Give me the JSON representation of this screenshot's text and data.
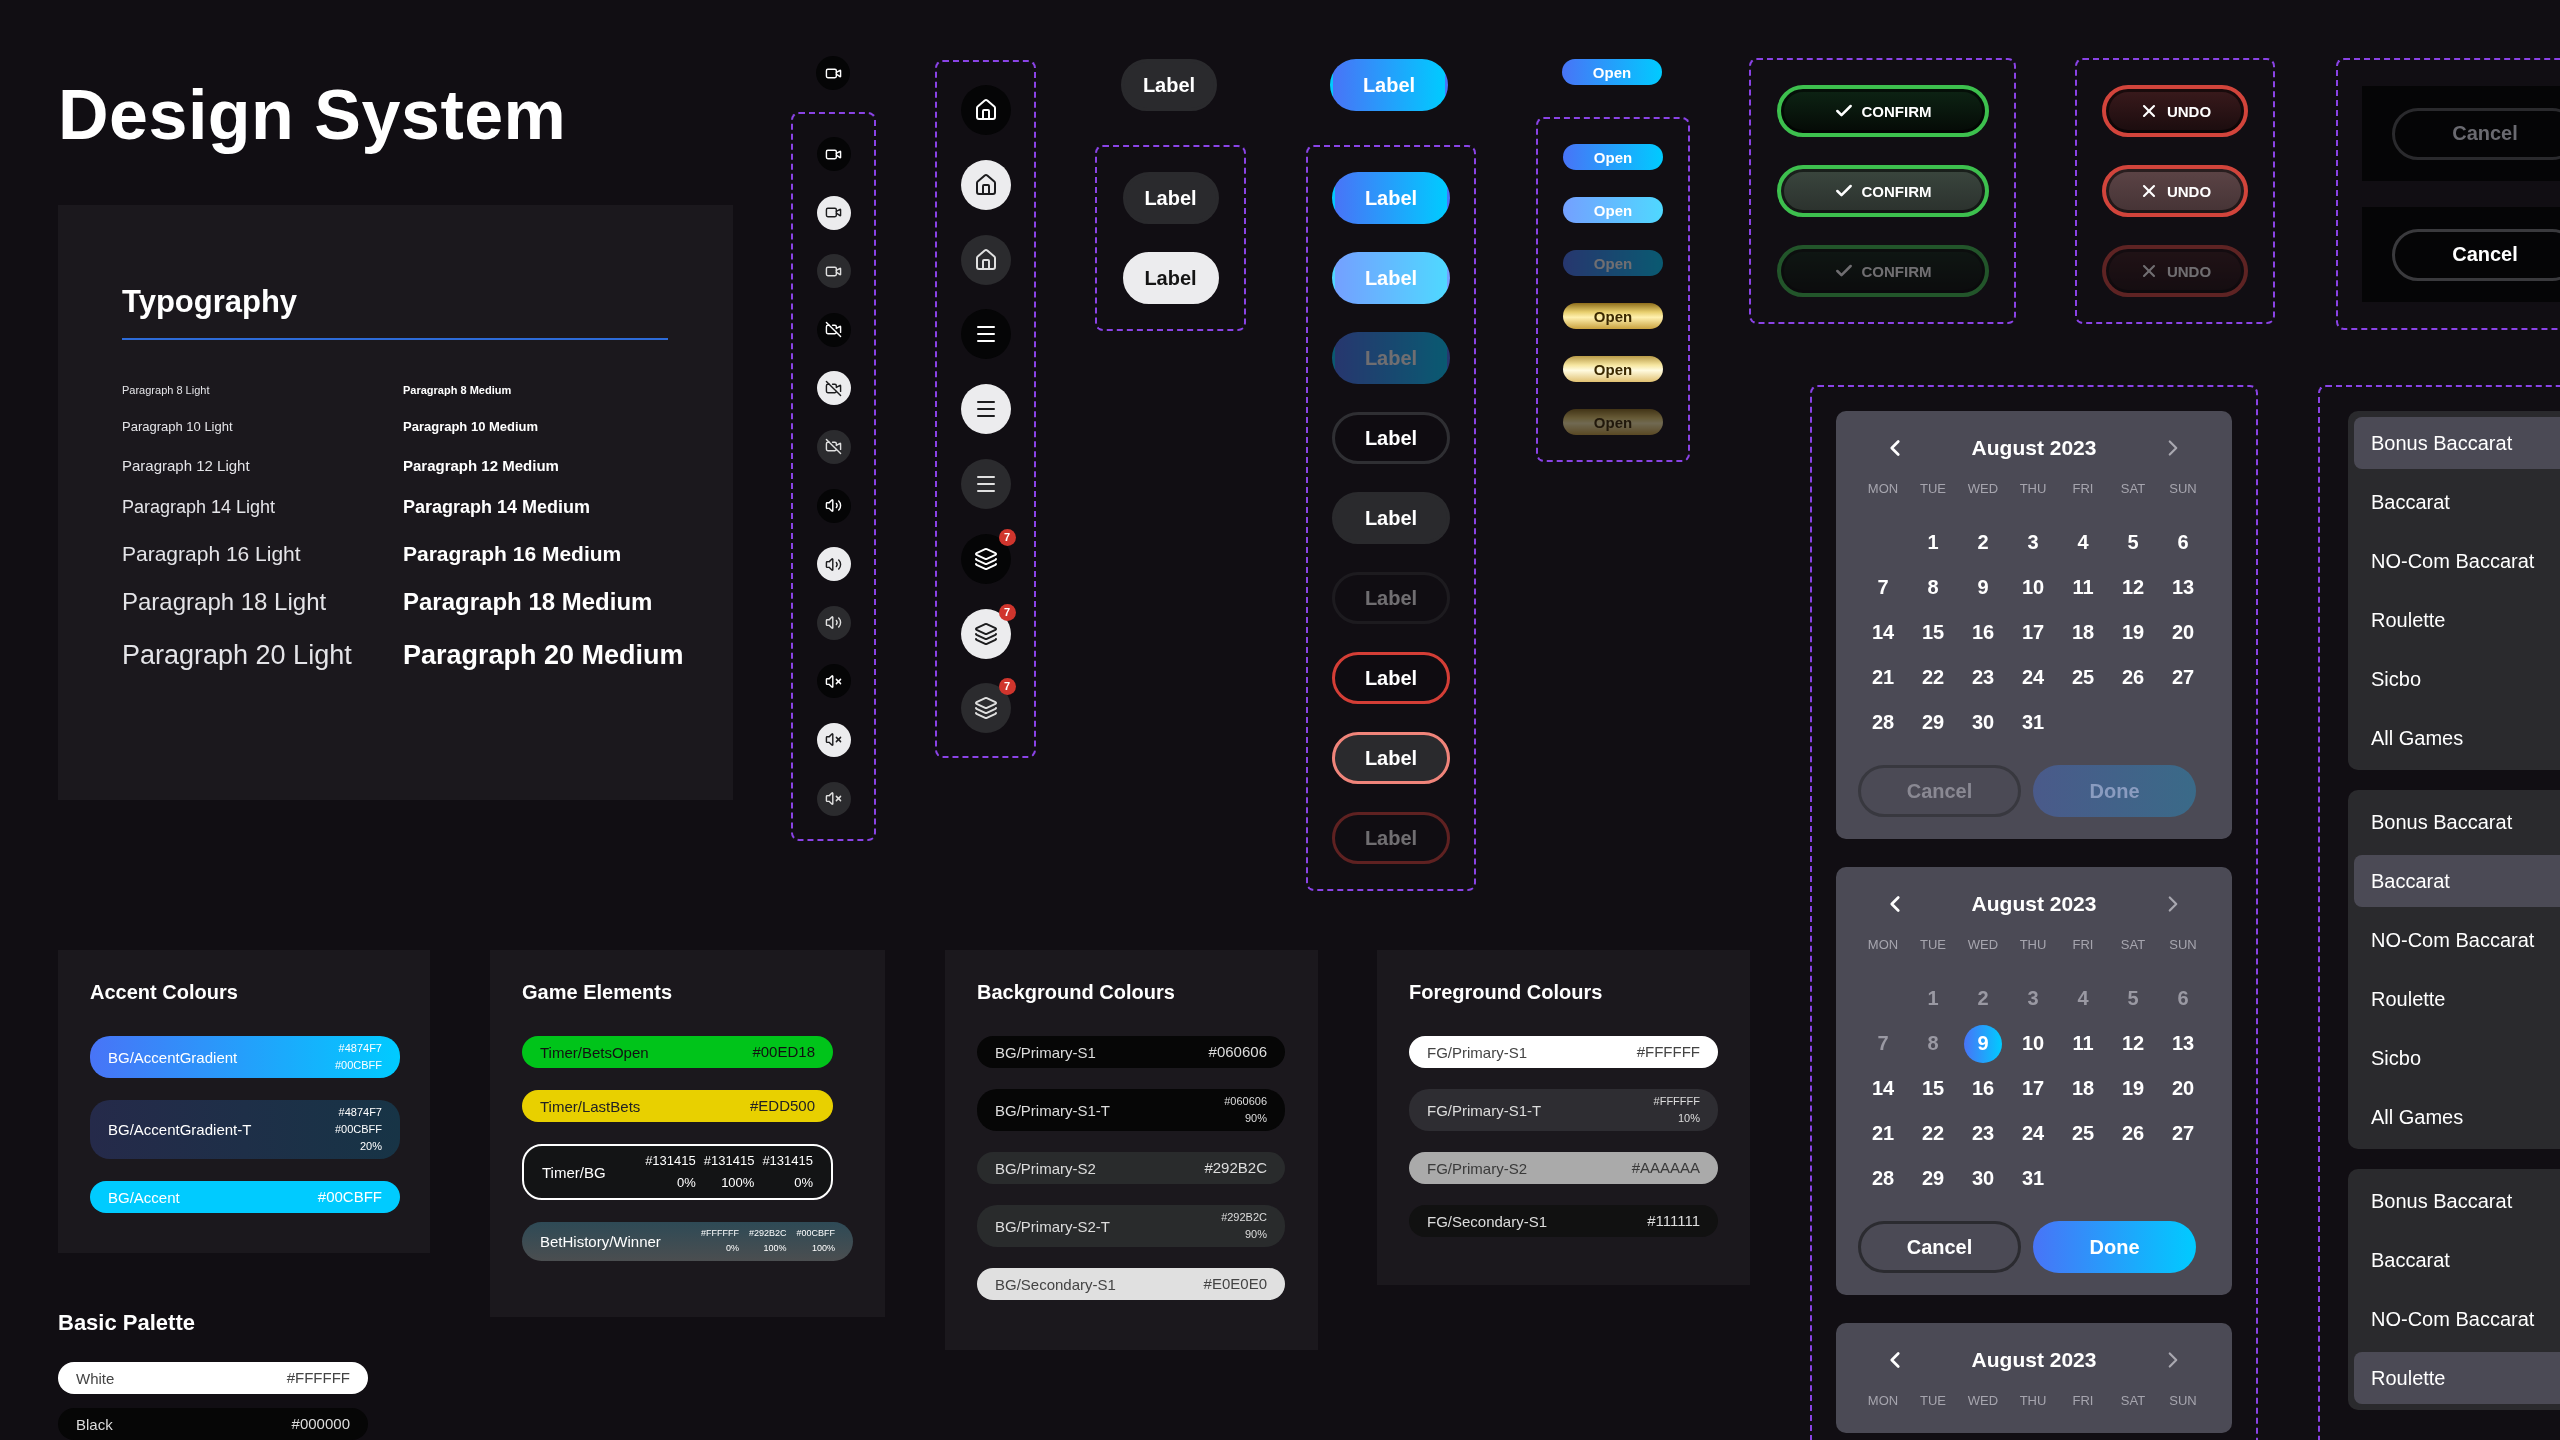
{
  "title": "Design System",
  "typography": {
    "heading": "Typography",
    "rows": [
      {
        "light": "Paragraph 8 Light",
        "medium": "Paragraph 8 Medium"
      },
      {
        "light": "Paragraph 10 Light",
        "medium": "Paragraph 10 Medium"
      },
      {
        "light": "Paragraph 12 Light",
        "medium": "Paragraph 12 Medium"
      },
      {
        "light": "Paragraph 14 Light",
        "medium": "Paragraph 14 Medium"
      },
      {
        "light": "Paragraph 16 Light",
        "medium": "Paragraph 16 Medium"
      },
      {
        "light": "Paragraph 18 Light",
        "medium": "Paragraph 18 Medium"
      },
      {
        "light": "Paragraph 20 Light",
        "medium": "Paragraph 20 Medium"
      }
    ]
  },
  "small_icon_buttons": {
    "sample": {
      "kind": "video"
    },
    "items": [
      {
        "kind": "video"
      },
      {
        "kind": "video"
      },
      {
        "kind": "video"
      },
      {
        "kind": "video-off"
      },
      {
        "kind": "video-off"
      },
      {
        "kind": "video-off"
      },
      {
        "kind": "volume"
      },
      {
        "kind": "volume"
      },
      {
        "kind": "volume"
      },
      {
        "kind": "mute"
      },
      {
        "kind": "mute"
      },
      {
        "kind": "mute"
      }
    ]
  },
  "large_icon_buttons": [
    {
      "kind": "home"
    },
    {
      "kind": "home"
    },
    {
      "kind": "home"
    },
    {
      "kind": "menu"
    },
    {
      "kind": "menu"
    },
    {
      "kind": "menu"
    },
    {
      "kind": "layers",
      "badge": "7"
    },
    {
      "kind": "layers",
      "badge": "7"
    },
    {
      "kind": "layers",
      "badge": "7"
    }
  ],
  "neutral_buttons": {
    "sample": {
      "label": "Label"
    },
    "items": [
      {
        "label": "Label"
      },
      {
        "label": "Label"
      }
    ]
  },
  "primary_buttons": {
    "sample": {
      "label": "Label"
    },
    "items": [
      {
        "label": "Label",
        "disabled": false
      },
      {
        "label": "Label",
        "disabled": false
      },
      {
        "label": "Label",
        "disabled": true
      },
      {
        "label": "Label",
        "disabled": false
      },
      {
        "label": "Label",
        "disabled": false
      },
      {
        "label": "Label",
        "disabled": true
      },
      {
        "label": "Label",
        "disabled": false
      },
      {
        "label": "Label",
        "disabled": false
      },
      {
        "label": "Label",
        "disabled": true
      }
    ]
  },
  "open_badges": {
    "sample": {
      "label": "Open"
    },
    "items": [
      {
        "label": "Open",
        "disabled": false
      },
      {
        "label": "Open",
        "disabled": false
      },
      {
        "label": "Open",
        "disabled": true
      },
      {
        "label": "Open",
        "disabled": false
      },
      {
        "label": "Open",
        "disabled": false
      },
      {
        "label": "Open",
        "disabled": true
      }
    ]
  },
  "confirm_buttons": [
    {
      "label": "CONFIRM",
      "disabled": false
    },
    {
      "label": "CONFIRM",
      "disabled": false
    },
    {
      "label": "CONFIRM",
      "disabled": true
    }
  ],
  "undo_buttons": [
    {
      "label": "UNDO",
      "disabled": false
    },
    {
      "label": "UNDO",
      "disabled": false
    },
    {
      "label": "UNDO",
      "disabled": true
    }
  ],
  "cancel_buttons": [
    {
      "label": "Cancel",
      "disabled": true
    },
    {
      "label": "Cancel",
      "disabled": false
    }
  ],
  "calendars": [
    {
      "month": "August 2023",
      "weekdays": [
        "MON",
        "TUE",
        "WED",
        "THU",
        "FRI",
        "SAT",
        "SUN"
      ],
      "weeks": [
        [
          {
            "label": "1",
            "muted": false,
            "selected": false
          },
          {
            "label": "2",
            "muted": false,
            "selected": false
          },
          {
            "label": "3",
            "muted": false,
            "selected": false
          },
          {
            "label": "4",
            "muted": false,
            "selected": false
          },
          {
            "label": "5",
            "muted": false,
            "selected": false
          },
          {
            "label": "6",
            "muted": false,
            "selected": false
          }
        ],
        [
          {
            "label": "7",
            "muted": false,
            "selected": false
          },
          {
            "label": "8",
            "muted": false,
            "selected": false
          },
          {
            "label": "9",
            "muted": false,
            "selected": false
          },
          {
            "label": "10",
            "muted": false,
            "selected": false
          },
          {
            "label": "11",
            "muted": false,
            "selected": false
          },
          {
            "label": "12",
            "muted": false,
            "selected": false
          },
          {
            "label": "13",
            "muted": false,
            "selected": false
          }
        ],
        [
          {
            "label": "14",
            "muted": false,
            "selected": false
          },
          {
            "label": "15",
            "muted": false,
            "selected": false
          },
          {
            "label": "16",
            "muted": false,
            "selected": false
          },
          {
            "label": "17",
            "muted": false,
            "selected": false
          },
          {
            "label": "18",
            "muted": false,
            "selected": false
          },
          {
            "label": "19",
            "muted": false,
            "selected": false
          },
          {
            "label": "20",
            "muted": false,
            "selected": false
          }
        ],
        [
          {
            "label": "21",
            "muted": false,
            "selected": false
          },
          {
            "label": "22",
            "muted": false,
            "selected": false
          },
          {
            "label": "23",
            "muted": false,
            "selected": false
          },
          {
            "label": "24",
            "muted": false,
            "selected": false
          },
          {
            "label": "25",
            "muted": false,
            "selected": false
          },
          {
            "label": "26",
            "muted": false,
            "selected": false
          },
          {
            "label": "27",
            "muted": false,
            "selected": false
          }
        ],
        [
          {
            "label": "28",
            "muted": false,
            "selected": false
          },
          {
            "label": "29",
            "muted": false,
            "selected": false
          },
          {
            "label": "30",
            "muted": false,
            "selected": false
          },
          {
            "label": "31",
            "muted": false,
            "selected": false
          }
        ]
      ],
      "buttons": [
        {
          "label": "Cancel",
          "kind": "secondary",
          "disabled": true
        },
        {
          "label": "Done",
          "kind": "primary",
          "disabled": true
        }
      ]
    },
    {
      "month": "August 2023",
      "weekdays": [
        "MON",
        "TUE",
        "WED",
        "THU",
        "FRI",
        "SAT",
        "SUN"
      ],
      "weeks": [
        [
          {
            "label": "1",
            "muted": true,
            "selected": false
          },
          {
            "label": "2",
            "muted": true,
            "selected": false
          },
          {
            "label": "3",
            "muted": true,
            "selected": false
          },
          {
            "label": "4",
            "muted": true,
            "selected": false
          },
          {
            "label": "5",
            "muted": true,
            "selected": false
          },
          {
            "label": "6",
            "muted": true,
            "selected": false
          }
        ],
        [
          {
            "label": "7",
            "muted": true,
            "selected": false
          },
          {
            "label": "8",
            "muted": true,
            "selected": false
          },
          {
            "label": "9",
            "muted": false,
            "selected": true
          },
          {
            "label": "10",
            "muted": false,
            "selected": false
          },
          {
            "label": "11",
            "muted": false,
            "selected": false
          },
          {
            "label": "12",
            "muted": false,
            "selected": false
          },
          {
            "label": "13",
            "muted": false,
            "selected": false
          }
        ],
        [
          {
            "label": "14",
            "muted": false,
            "selected": false
          },
          {
            "label": "15",
            "muted": false,
            "selected": false
          },
          {
            "label": "16",
            "muted": false,
            "selected": false
          },
          {
            "label": "17",
            "muted": false,
            "selected": false
          },
          {
            "label": "18",
            "muted": false,
            "selected": false
          },
          {
            "label": "19",
            "muted": false,
            "selected": false
          },
          {
            "label": "20",
            "muted": false,
            "selected": false
          }
        ],
        [
          {
            "label": "21",
            "muted": false,
            "selected": false
          },
          {
            "label": "22",
            "muted": false,
            "selected": false
          },
          {
            "label": "23",
            "muted": false,
            "selected": false
          },
          {
            "label": "24",
            "muted": false,
            "selected": false
          },
          {
            "label": "25",
            "muted": false,
            "selected": false
          },
          {
            "label": "26",
            "muted": false,
            "selected": false
          },
          {
            "label": "27",
            "muted": false,
            "selected": false
          }
        ],
        [
          {
            "label": "28",
            "muted": false,
            "selected": false
          },
          {
            "label": "29",
            "muted": false,
            "selected": false
          },
          {
            "label": "30",
            "muted": false,
            "selected": false
          },
          {
            "label": "31",
            "muted": false,
            "selected": false
          }
        ]
      ],
      "buttons": [
        {
          "label": "Cancel",
          "kind": "secondary",
          "disabled": false
        },
        {
          "label": "Done",
          "kind": "primary",
          "disabled": false
        }
      ]
    },
    {
      "month": "August 2023",
      "weekdays": [
        "MON",
        "TUE",
        "WED",
        "THU",
        "FRI",
        "SAT",
        "SUN"
      ]
    }
  ],
  "game_lists": [
    {
      "items": [
        {
          "label": "Bonus Baccarat",
          "selected": true
        },
        {
          "label": "Baccarat",
          "selected": false
        },
        {
          "label": "NO-Com Baccarat",
          "selected": false
        },
        {
          "label": "Roulette",
          "selected": false
        },
        {
          "label": "Sicbo",
          "selected": false
        },
        {
          "label": "All Games",
          "selected": false
        }
      ]
    },
    {
      "items": [
        {
          "label": "Bonus Baccarat",
          "selected": false
        },
        {
          "label": "Baccarat",
          "selected": true
        },
        {
          "label": "NO-Com Baccarat",
          "selected": false
        },
        {
          "label": "Roulette",
          "selected": false
        },
        {
          "label": "Sicbo",
          "selected": false
        },
        {
          "label": "All Games",
          "selected": false
        }
      ]
    },
    {
      "items": [
        {
          "label": "Bonus Baccarat",
          "selected": false
        },
        {
          "label": "Baccarat",
          "selected": false
        },
        {
          "label": "NO-Com Baccarat",
          "selected": false
        },
        {
          "label": "Roulette",
          "selected": true
        }
      ]
    }
  ],
  "accent_colours": {
    "heading": "Accent Colours",
    "swatches": [
      {
        "kind": "gradient",
        "name": "BG/AccentGradient",
        "values": [
          "#4874F7",
          "#00CBFF"
        ]
      },
      {
        "kind": "tint",
        "name": "BG/AccentGradient-T",
        "values": [
          "#4874F7",
          "#00CBFF",
          "20%"
        ]
      },
      {
        "kind": "accent",
        "name": "BG/Accent",
        "values": [
          "#00CBFF"
        ]
      }
    ]
  },
  "basic_palette": {
    "heading": "Basic Palette",
    "swatches": [
      {
        "kind": "white",
        "name": "White",
        "values": [
          "#FFFFFF"
        ]
      },
      {
        "kind": "black",
        "name": "Black",
        "values": [
          "#000000"
        ]
      }
    ]
  },
  "game_elements": {
    "heading": "Game Elements",
    "swatches": [
      {
        "kind": "green",
        "name": "Timer/BetsOpen",
        "values": [
          "#00ED18"
        ]
      },
      {
        "kind": "yellow",
        "name": "Timer/LastBets",
        "values": [
          "#EDD500"
        ]
      },
      {
        "kind": "outlined",
        "name": "Timer/BG",
        "stops": [
          {
            "code": "#131415",
            "alpha": "0%"
          },
          {
            "code": "#131415",
            "alpha": "100%"
          },
          {
            "code": "#131415",
            "alpha": "0%"
          }
        ]
      },
      {
        "kind": "winner",
        "name": "BetHistory/Winner",
        "stops": [
          {
            "code": "#FFFFFF",
            "alpha": "0%"
          },
          {
            "code": "#292B2C",
            "alpha": "100%"
          },
          {
            "code": "#00CBFF",
            "alpha": "100%"
          }
        ]
      }
    ]
  },
  "background_colours": {
    "heading": "Background Colours",
    "swatches": [
      {
        "kind": "black",
        "name": "BG/Primary-S1",
        "values": [
          "#060606"
        ]
      },
      {
        "kind": "black",
        "name": "BG/Primary-S1-T",
        "values": [
          "#060606",
          "90%"
        ]
      },
      {
        "kind": "charcoal",
        "name": "BG/Primary-S2",
        "values": [
          "#292B2C"
        ]
      },
      {
        "kind": "charcoal",
        "name": "BG/Primary-S2-T",
        "values": [
          "#292B2C",
          "90%"
        ]
      },
      {
        "kind": "silver",
        "name": "BG/Secondary-S1",
        "values": [
          "#E0E0E0"
        ]
      }
    ]
  },
  "foreground_colours": {
    "heading": "Foreground Colours",
    "swatches": [
      {
        "kind": "white",
        "name": "FG/Primary-S1",
        "values": [
          "#FFFFFF"
        ]
      },
      {
        "kind": "graphite",
        "name": "FG/Primary-S1-T",
        "values": [
          "#FFFFFF",
          "10%"
        ]
      },
      {
        "kind": "gray",
        "name": "FG/Primary-S2",
        "values": [
          "#AAAAAA"
        ]
      },
      {
        "kind": "ink",
        "name": "FG/Secondary-S1",
        "values": [
          "#111111"
        ]
      }
    ]
  }
}
